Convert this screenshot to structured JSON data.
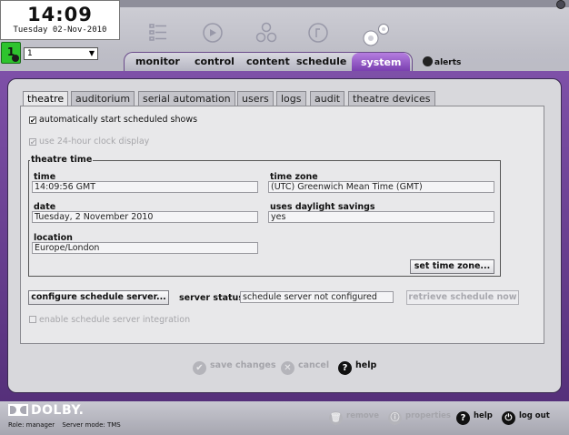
{
  "clock": {
    "time": "14:09",
    "date": "Tuesday 02-Nov-2010"
  },
  "screen": {
    "badge": "1",
    "selected": "1"
  },
  "nav": {
    "items": [
      {
        "label": "monitor"
      },
      {
        "label": "control"
      },
      {
        "label": "content"
      },
      {
        "label": "schedule"
      },
      {
        "label": "system"
      }
    ],
    "active": "system",
    "alerts_label": "alerts"
  },
  "tabs": [
    {
      "label": "theatre"
    },
    {
      "label": "auditorium"
    },
    {
      "label": "serial automation"
    },
    {
      "label": "users"
    },
    {
      "label": "logs"
    },
    {
      "label": "audit"
    },
    {
      "label": "theatre devices"
    }
  ],
  "active_tab": "theatre",
  "settings": {
    "auto_start_label": "automatically start scheduled shows",
    "auto_start_checked": true,
    "clock24_label": "use 24-hour clock display",
    "clock24_checked": true,
    "clock24_disabled": true
  },
  "theatre_time": {
    "group_title": "theatre time",
    "time_label": "time",
    "time_value": "14:09:56 GMT",
    "timezone_label": "time zone",
    "timezone_value": "(UTC) Greenwich Mean Time (GMT)",
    "date_label": "date",
    "date_value": "Tuesday, 2 November 2010",
    "dst_label": "uses daylight savings",
    "dst_value": "yes",
    "location_label": "location",
    "location_value": "Europe/London",
    "set_timezone_button": "set time zone..."
  },
  "schedule_server": {
    "configure_button": "configure schedule server...",
    "status_label": "server status",
    "status_value": "schedule server not configured",
    "retrieve_button": "retrieve schedule now",
    "enable_label": "enable schedule server integration"
  },
  "actions": {
    "save_label": "save changes",
    "cancel_label": "cancel",
    "help_label": "help"
  },
  "footer": {
    "logo_text": "DOLBY.",
    "role": "Role: manager",
    "server_mode": "Server mode: TMS",
    "remove_label": "remove",
    "properties_label": "properties",
    "help_label": "help",
    "logout_label": "log out"
  }
}
